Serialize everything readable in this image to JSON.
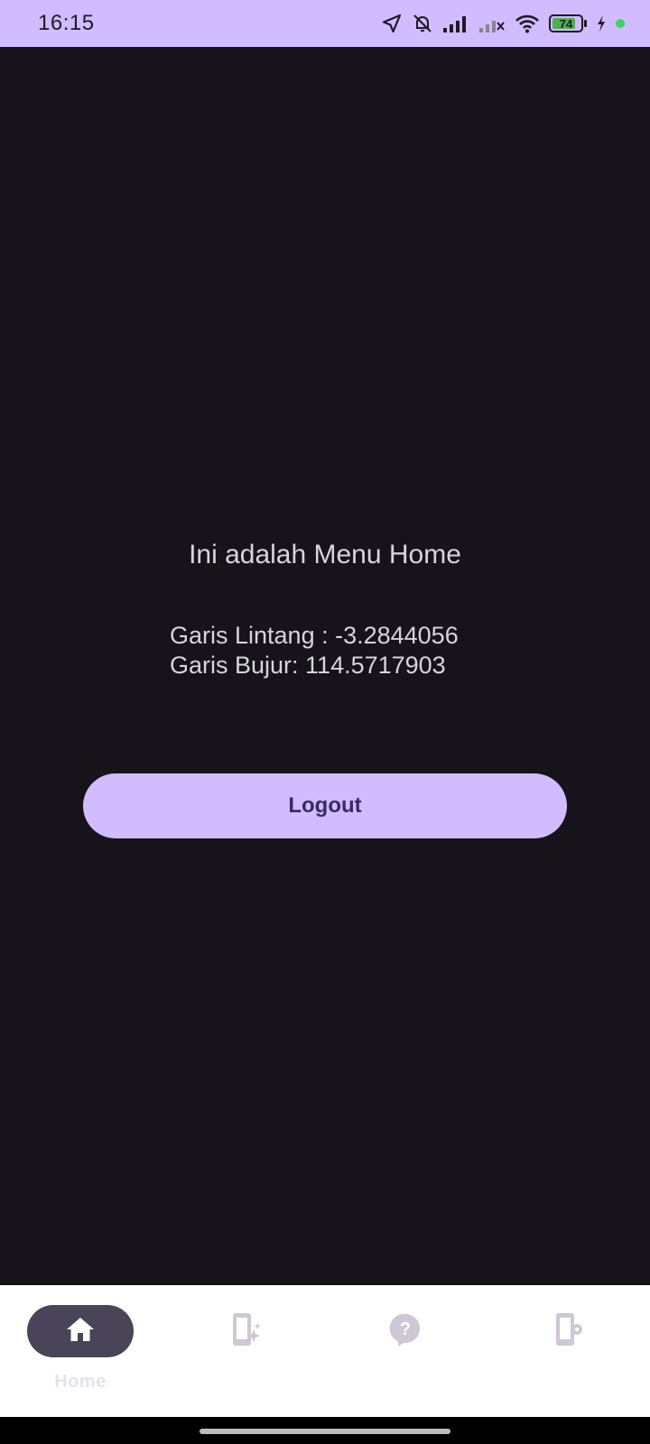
{
  "status_bar": {
    "time": "16:15",
    "battery_level": "74",
    "icons": [
      "location-arrow-icon",
      "bell-off-icon",
      "signal-icon",
      "signal-no-service-icon",
      "wifi-icon",
      "battery-icon",
      "charging-bolt-icon",
      "privacy-dot-icon"
    ]
  },
  "home": {
    "title": "Ini adalah Menu Home",
    "latitude_line": "Garis Lintang : -3.2844056",
    "longitude_line": "Garis Bujur: 114.5717903",
    "logout_label": "Logout"
  },
  "bottom_nav": {
    "items": [
      {
        "label": "Home",
        "icon": "home-icon",
        "active": true
      },
      {
        "label": "",
        "icon": "phone-sparkle-icon",
        "active": false
      },
      {
        "label": "",
        "icon": "help-bubble-icon",
        "active": false
      },
      {
        "label": "",
        "icon": "phone-settings-icon",
        "active": false
      }
    ]
  },
  "colors": {
    "status_bar_bg": "#d0bcff",
    "background": "#16131a",
    "button_bg": "#d0bcff",
    "button_text": "#3b2a66",
    "nav_bg": "#ffffff",
    "nav_active_indicator": "#4a4458",
    "nav_icon_inactive": "#cfc6d6"
  }
}
